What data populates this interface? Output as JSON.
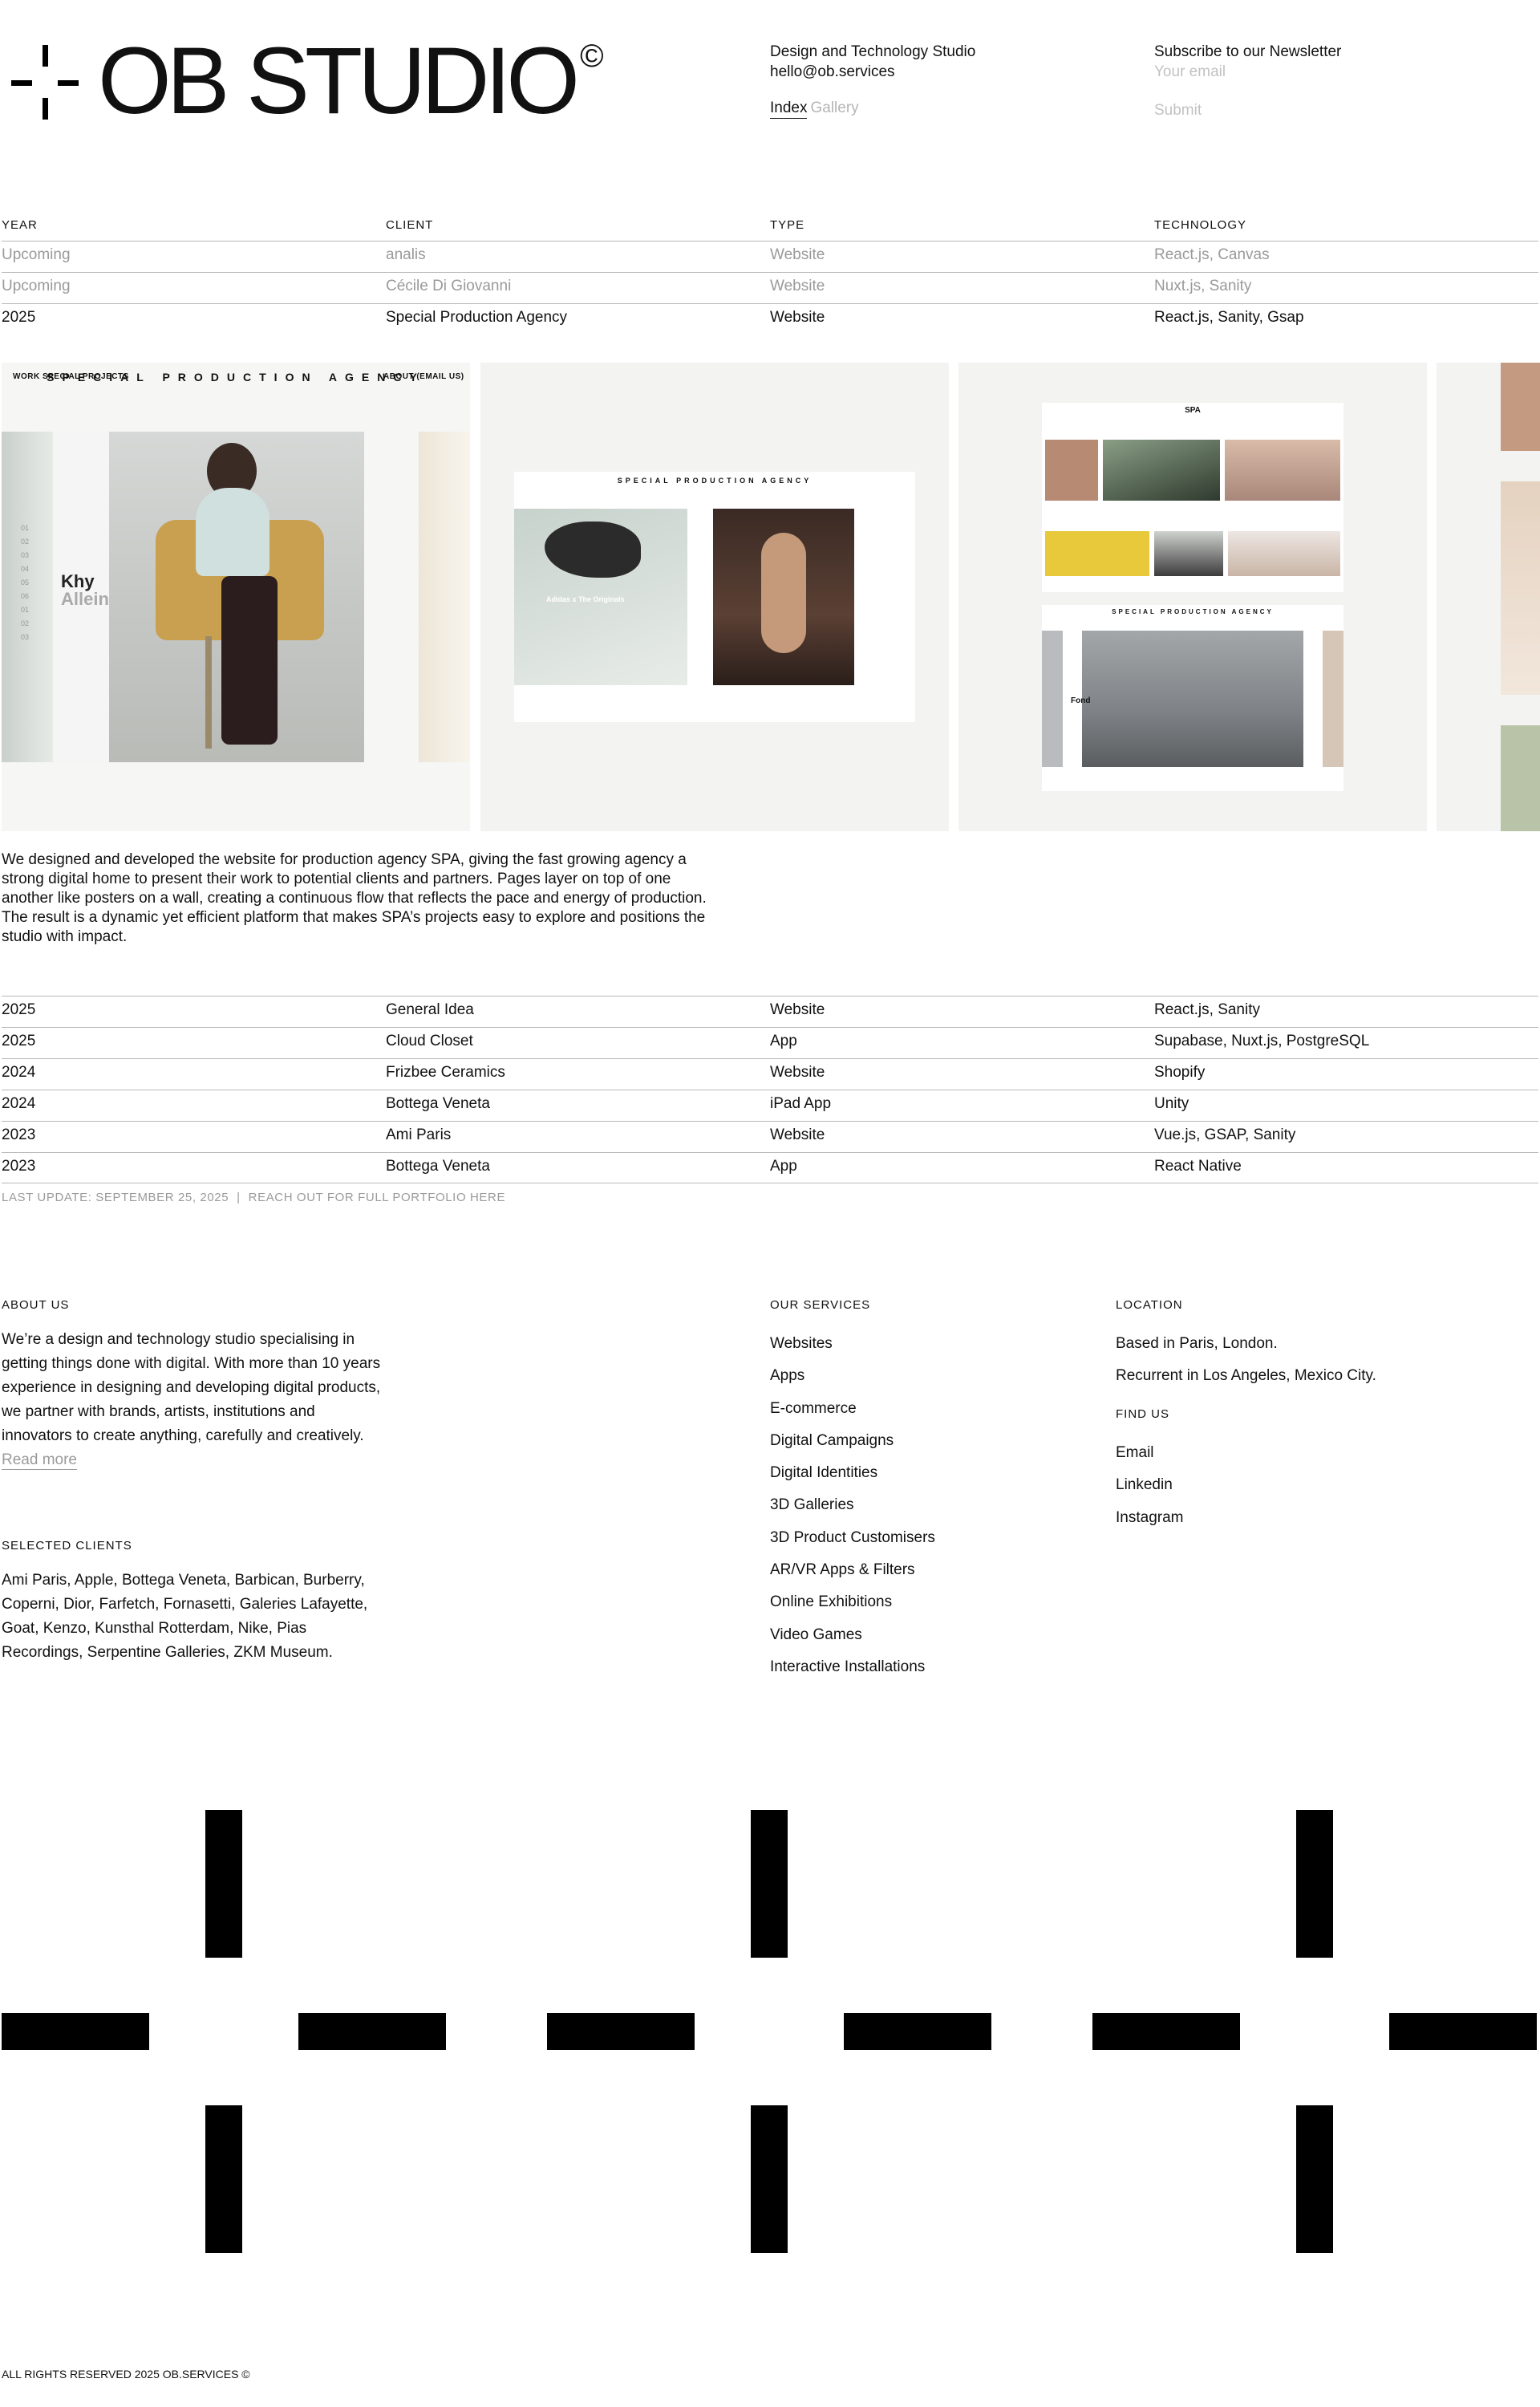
{
  "brand": {
    "logo_text": "OB STUDIO",
    "logo_symbol": "©",
    "tagline": "Design and Technology Studio",
    "email": "hello@ob.services"
  },
  "nav": {
    "index": "Index",
    "gallery": "Gallery"
  },
  "newsletter": {
    "title": "Subscribe to our Newsletter",
    "placeholder": "Your email",
    "submit": "Submit"
  },
  "table": {
    "headers": [
      "YEAR",
      "CLIENT",
      "TYPE",
      "TECHNOLOGY"
    ],
    "top_rows": [
      {
        "year": "Upcoming",
        "client": "analis",
        "type": "Website",
        "tech": "React.js, Canvas"
      },
      {
        "year": "Upcoming",
        "client": "Cécile Di Giovanni",
        "type": "Website",
        "tech": "Nuxt.js, Sanity"
      },
      {
        "year": "2025",
        "client": "Special Production Agency",
        "type": "Website",
        "tech": "React.js, Sanity, Gsap"
      }
    ],
    "bottom_rows": [
      {
        "year": "2025",
        "client": "General Idea",
        "type": "Website",
        "tech": "React.js, Sanity"
      },
      {
        "year": "2025",
        "client": "Cloud Closet",
        "type": "App",
        "tech": "Supabase, Nuxt.js, PostgreSQL"
      },
      {
        "year": "2024",
        "client": "Frizbee Ceramics",
        "type": "Website",
        "tech": "Shopify"
      },
      {
        "year": "2024",
        "client": "Bottega Veneta",
        "type": "iPad App",
        "tech": "Unity"
      },
      {
        "year": "2023",
        "client": "Ami Paris",
        "type": "Website",
        "tech": "Vue.js, GSAP, Sanity"
      },
      {
        "year": "2023",
        "client": "Bottega Veneta",
        "type": "App",
        "tech": "React Native"
      }
    ]
  },
  "gallery": {
    "panel1": {
      "nav_left": "WORK   SPECIAL PROJECTS",
      "title": "SPECIAL   PRODUCTION   AGENCY",
      "nav_right": "ABOUT   (EMAIL US)",
      "side_index": [
        "01",
        "02",
        "03",
        "04",
        "05",
        "06",
        "01",
        "02",
        "03"
      ],
      "side_name": "Khy",
      "side_name2": "Allein"
    },
    "panel2": {
      "title": "SPECIAL   PRODUCTION   AGENCY",
      "caption": "Adidas x The Originals"
    },
    "panel3": {
      "title": "SPA",
      "title2": "SPECIAL   PRODUCTION   AGENCY",
      "caption": "Fond"
    }
  },
  "description": "We designed and developed the website for production agency SPA, giving the fast growing agency a strong digital home to present their work to potential clients and partners. Pages layer on top of one another like posters on a wall, creating a continuous flow that reflects the pace and energy of production. The result is a dynamic yet efficient platform that makes SPA’s projects easy to explore and positions the studio with impact.",
  "footnote": {
    "last_update": "LAST UPDATE: SEPTEMBER 25, 2025",
    "separator": "|",
    "portfolio_link": "REACH OUT FOR FULL PORTFOLIO HERE"
  },
  "about": {
    "label": "ABOUT US",
    "text": "We’re a design and technology studio specialising in getting things done with digital. With more than 10 years experience in designing and developing digital products, we partner with brands, artists, institutions and innovators to create anything, carefully and creatively.",
    "read_more": "Read more"
  },
  "clients": {
    "label": "SELECTED CLIENTS",
    "text": "Ami Paris, Apple, Bottega Veneta, Barbican, Burberry, Coperni, Dior, Farfetch, Fornasetti, Galeries Lafayette, Goat, Kenzo, Kunsthal Rotterdam, Nike, Pias Recordings, Serpentine Galleries, ZKM Museum."
  },
  "services": {
    "label": "OUR SERVICES",
    "items": [
      "Websites",
      "Apps",
      "E-commerce",
      "Digital Campaigns",
      "Digital Identities",
      "3D Galleries",
      "3D Product Customisers",
      "AR/VR Apps & Filters",
      "Online Exhibitions",
      "Video Games",
      "Interactive Installations"
    ]
  },
  "location": {
    "label": "LOCATION",
    "items": [
      "Based in Paris, London.",
      "Recurrent in Los Angeles, Mexico City."
    ]
  },
  "find_us": {
    "label": "FIND US",
    "items": [
      "Email",
      "Linkedin",
      "Instagram"
    ]
  },
  "copyright": "ALL RIGHTS RESERVED 2025 OB.SERVICES ©"
}
